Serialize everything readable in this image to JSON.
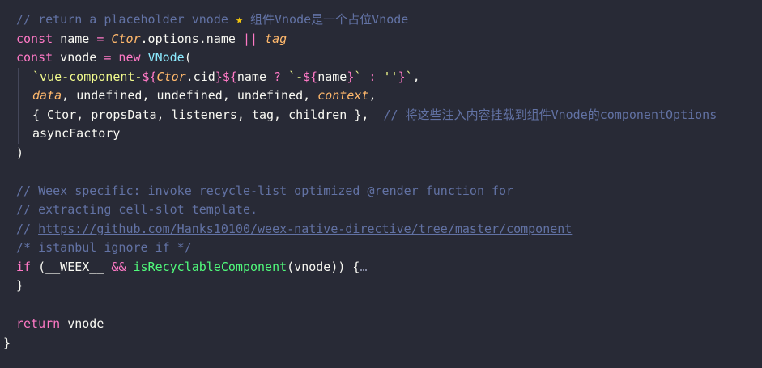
{
  "code": {
    "line1": {
      "comment": "// return a placeholder vnode ",
      "star": "★",
      "comment_cn": " 组件Vnode是一个占位Vnode"
    },
    "line2": {
      "kw": "const",
      "name": " name ",
      "eq": "=",
      "ctor": " Ctor",
      "rest": ".options.name ",
      "or": "||",
      "tag": " tag"
    },
    "line3": {
      "kw": "const",
      "name": " vnode ",
      "eq": "=",
      "new": " new",
      "cls": " VNode",
      "paren": "("
    },
    "line4": {
      "str1": "`vue-component-",
      "interp_open1": "${",
      "ctor": "Ctor",
      "cid": ".cid",
      "interp_close1": "}",
      "interp_open2": "${",
      "name": "name",
      "tern": " ? ",
      "str2": "`-",
      "interp_open3": "${",
      "name2": "name",
      "interp_close3": "}",
      "str3": "`",
      "colon": " : ",
      "str4": "''",
      "interp_close2": "}",
      "str5": "`",
      "comma": ","
    },
    "line5": {
      "data": "data",
      "c1": ", ",
      "u1": "undefined",
      "c2": ", ",
      "u2": "undefined",
      "c3": ", ",
      "u3": "undefined",
      "c4": ", ",
      "ctx": "context",
      "c5": ","
    },
    "line6": {
      "code": "{ Ctor, propsData, listeners, tag, children },",
      "comment": "  // 将这些注入内容挂载到组件Vnode的componentOptions"
    },
    "line7": {
      "code": "asyncFactory"
    },
    "line8": {
      "code": ")"
    },
    "line10": {
      "comment": "// Weex specific: invoke recycle-list optimized @render function for"
    },
    "line11": {
      "comment": "// extracting cell-slot template."
    },
    "line12": {
      "prefix": "// ",
      "url": "https://github.com/Hanks10100/weex-native-directive/tree/master/component"
    },
    "line13": {
      "comment": "/* istanbul ignore if */"
    },
    "line14": {
      "kw": "if",
      "open": " (",
      "weex": "__WEEX__",
      "and": " && ",
      "fn": "isRecyclableComponent",
      "args": "(vnode)",
      "close": ") {",
      "ellipsis": "…"
    },
    "line15": {
      "code": "}"
    },
    "line17": {
      "kw": "return",
      "var": " vnode"
    },
    "line18": {
      "code": "}"
    }
  }
}
